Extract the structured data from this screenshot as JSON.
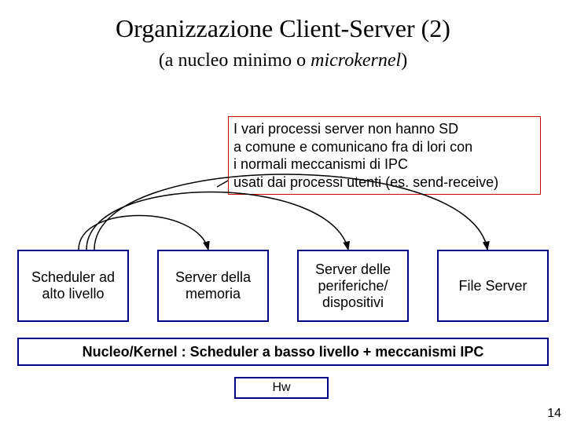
{
  "title": "Organizzazione Client-Server (2)",
  "subtitle_prefix": "(a nucleo minimo o ",
  "subtitle_italic": "microkernel",
  "subtitle_suffix": ")",
  "info": {
    "line1": "I vari processi server non hanno SD",
    "line2": "a comune e comunicano fra di lori con",
    "line3": "i normali meccanismi di IPC",
    "line4": "usati dai processi utenti (es. send-receive)"
  },
  "boxes": {
    "b1": "Scheduler ad alto livello",
    "b2": "Server della memoria",
    "b3": "Server delle periferiche/ dispositivi",
    "b4": "File Server"
  },
  "kernel": "Nucleo/Kernel : Scheduler a basso livello + meccanismi IPC",
  "hw": "Hw",
  "page": "14"
}
